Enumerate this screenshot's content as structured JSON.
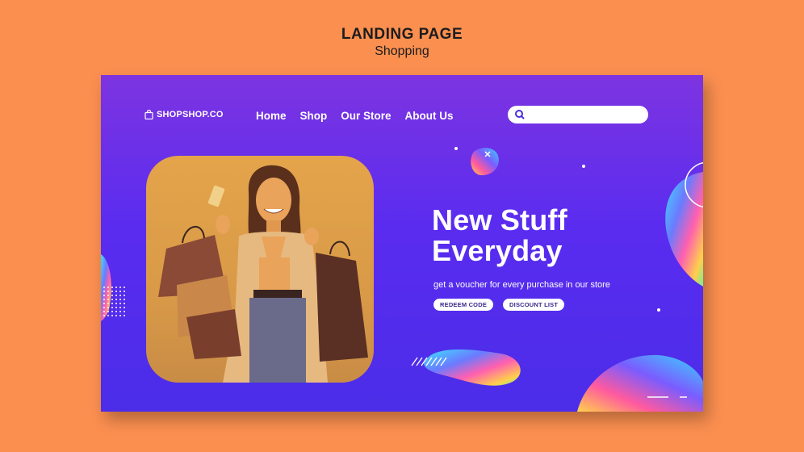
{
  "heading": {
    "title": "LANDING PAGE",
    "subtitle": "Shopping"
  },
  "site": {
    "logo_text": "SHOPSHOP.CO",
    "nav": [
      "Home",
      "Shop",
      "Our Store",
      "About Us"
    ],
    "search": {
      "placeholder": "",
      "value": ""
    }
  },
  "hero": {
    "headline_line1": "New Stuff",
    "headline_line2": "Everyday",
    "subline": "get a voucher for every purchase in our store",
    "buttons": [
      "REDEEM CODE",
      "DISCOUNT LIST"
    ]
  },
  "colors": {
    "background": "#fb8f50",
    "card_gradient_top": "#7d34e0",
    "card_gradient_bottom": "#4b2de8",
    "text": "#ffffff"
  },
  "icons": [
    "bag-icon",
    "search-icon"
  ]
}
